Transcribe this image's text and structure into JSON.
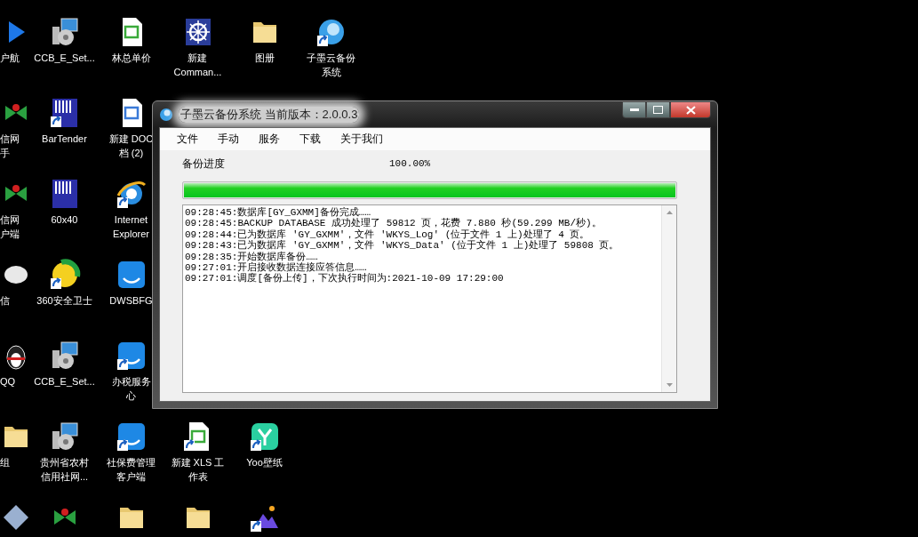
{
  "desktop": {
    "columns": [
      {
        "top": [
          {
            "lines": [
              "户航"
            ],
            "kind": "blue-swirl",
            "shortcut": false
          },
          {
            "lines": [
              "信网",
              "手"
            ],
            "kind": "green-logo",
            "shortcut": false
          },
          {
            "lines": [
              "信网",
              "户端"
            ],
            "kind": "green-logo",
            "shortcut": false
          },
          {
            "lines": [
              "信"
            ],
            "kind": "chat",
            "shortcut": false
          },
          {
            "lines": [
              "QQ"
            ],
            "kind": "penguin",
            "shortcut": false
          },
          {
            "lines": [
              "组"
            ],
            "kind": "folder",
            "shortcut": false
          },
          {
            "kind": "diamond",
            "shortcut": false
          }
        ]
      },
      {
        "top": [
          {
            "lines": [
              "CCB_E_Set..."
            ],
            "kind": "installer",
            "shortcut": false
          },
          {
            "lines": [
              "BarTender"
            ],
            "kind": "barcode",
            "shortcut": true
          },
          {
            "lines": [
              "60x40"
            ],
            "kind": "barcode",
            "shortcut": false
          },
          {
            "lines": [
              "360安全卫士"
            ],
            "kind": "shield",
            "shortcut": true
          },
          {
            "lines": [
              "CCB_E_Set..."
            ],
            "kind": "installer",
            "shortcut": false
          },
          {
            "lines": [
              "贵州省农村",
              "信用社网..."
            ],
            "kind": "installer",
            "shortcut": false
          },
          {
            "kind": "green-logo",
            "shortcut": false
          }
        ]
      },
      {
        "top": [
          {
            "lines": [
              "林总单价"
            ],
            "kind": "sheet",
            "shortcut": false
          },
          {
            "lines": [
              "新建 DOC",
              "档 (2)"
            ],
            "kind": "doc",
            "shortcut": false
          },
          {
            "lines": [
              "Internet",
              "Explorer"
            ],
            "kind": "browser",
            "shortcut": true
          },
          {
            "lines": [
              "DWSBFG"
            ],
            "kind": "blue-app",
            "shortcut": false
          },
          {
            "lines": [
              "办税服务",
              "心"
            ],
            "kind": "blue-app",
            "shortcut": true
          },
          {
            "lines": [
              "社保费管理",
              "客户端"
            ],
            "kind": "blue-app",
            "shortcut": true
          },
          {
            "kind": "folder",
            "shortcut": false
          }
        ]
      },
      {
        "top": [
          {
            "lines": [
              "新建",
              "Comman..."
            ],
            "kind": "gear-doc",
            "shortcut": false
          }
        ],
        "bottom": [
          {
            "lines": [
              "新建 XLS 工",
              "作表"
            ],
            "kind": "sheet",
            "shortcut": true
          },
          {
            "kind": "folder",
            "shortcut": false
          }
        ]
      },
      {
        "top": [
          {
            "lines": [
              "图册"
            ],
            "kind": "folder",
            "shortcut": false
          }
        ],
        "bottom": [
          {
            "lines": [
              "Yoo壁纸"
            ],
            "kind": "green-app",
            "shortcut": true
          },
          {
            "kind": "picture",
            "shortcut": true
          }
        ]
      },
      {
        "top": [
          {
            "lines": [
              "子墨云备份",
              "系统"
            ],
            "kind": "cloud",
            "shortcut": true
          }
        ]
      }
    ]
  },
  "window": {
    "title": "子墨云备份系统  当前版本：2.0.0.3",
    "menu": [
      "文件",
      "手动",
      "服务",
      "下载",
      "关于我们"
    ],
    "progress": {
      "label": "备份进度",
      "reading": "100.00%",
      "level": 1.0
    },
    "log": [
      "09:28:45:数据库[GY_GXMM]备份完成……",
      "09:28:45:BACKUP DATABASE 成功处理了 59812 页，花费 7.880 秒(59.299 MB/秒)。",
      "09:28:44:已为数据库 'GY_GXMM'，文件 'WKYS_Log' (位于文件 1 上)处理了 4 页。",
      "09:28:43:已为数据库 'GY_GXMM'，文件 'WKYS_Data' (位于文件 1 上)处理了 59808 页。",
      "09:28:35:开始数据库备份……",
      "09:27:01:开启接收数据连接应答信息……",
      "09:27:01:调度[备份上传]，下次执行时间为:2021-10-09 17:29:00"
    ]
  }
}
